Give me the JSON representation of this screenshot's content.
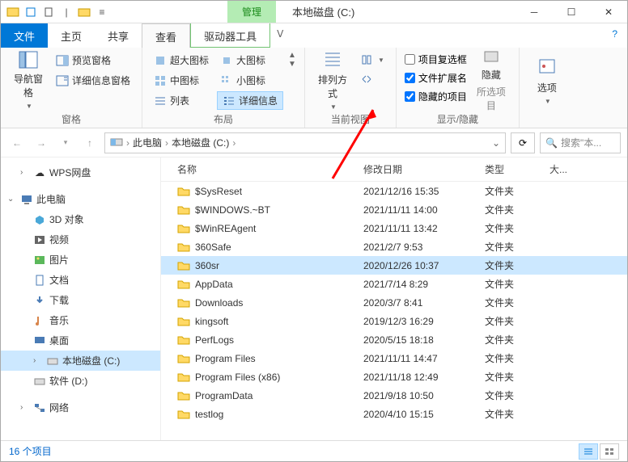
{
  "titlebar": {
    "manage_tab": "管理",
    "title": "本地磁盘 (C:)"
  },
  "menutabs": {
    "file": "文件",
    "home": "主页",
    "share": "共享",
    "view": "查看",
    "drive_tools": "驱动器工具"
  },
  "ribbon": {
    "panes": {
      "nav_pane": "导航窗格",
      "preview_pane": "预览窗格",
      "details_pane": "详细信息窗格",
      "group_label": "窗格"
    },
    "layout": {
      "xl_icons": "超大图标",
      "lg_icons": "大图标",
      "md_icons": "中图标",
      "sm_icons": "小图标",
      "list": "列表",
      "details": "详细信息",
      "group_label": "布局"
    },
    "current_view": {
      "sort_by": "排列方式",
      "group_label": "当前视图"
    },
    "show_hide": {
      "item_checkboxes": "项目复选框",
      "file_ext": "文件扩展名",
      "hidden_items": "隐藏的项目",
      "hide_selected": "隐藏",
      "hide_selected2": "所选项目",
      "group_label": "显示/隐藏"
    },
    "options": {
      "label": "选项"
    }
  },
  "breadcrumb": {
    "this_pc": "此电脑",
    "drive": "本地磁盘 (C:)"
  },
  "search": {
    "placeholder": "搜索\"本..."
  },
  "columns": {
    "name": "名称",
    "date": "修改日期",
    "type": "类型",
    "size": "大..."
  },
  "sidebar": {
    "wps": "WPS网盘",
    "this_pc": "此电脑",
    "objects3d": "3D 对象",
    "videos": "视频",
    "pictures": "图片",
    "documents": "文档",
    "downloads": "下载",
    "music": "音乐",
    "desktop": "桌面",
    "drive_c": "本地磁盘 (C:)",
    "drive_d": "软件 (D:)",
    "network": "网络"
  },
  "files": [
    {
      "name": "$SysReset",
      "date": "2021/12/16 15:35",
      "type": "文件夹"
    },
    {
      "name": "$WINDOWS.~BT",
      "date": "2021/11/11 14:00",
      "type": "文件夹"
    },
    {
      "name": "$WinREAgent",
      "date": "2021/11/11 13:42",
      "type": "文件夹"
    },
    {
      "name": "360Safe",
      "date": "2021/2/7 9:53",
      "type": "文件夹"
    },
    {
      "name": "360sr",
      "date": "2020/12/26 10:37",
      "type": "文件夹"
    },
    {
      "name": "AppData",
      "date": "2021/7/14 8:29",
      "type": "文件夹"
    },
    {
      "name": "Downloads",
      "date": "2020/3/7 8:41",
      "type": "文件夹"
    },
    {
      "name": "kingsoft",
      "date": "2019/12/3 16:29",
      "type": "文件夹"
    },
    {
      "name": "PerfLogs",
      "date": "2020/5/15 18:18",
      "type": "文件夹"
    },
    {
      "name": "Program Files",
      "date": "2021/11/11 14:47",
      "type": "文件夹"
    },
    {
      "name": "Program Files (x86)",
      "date": "2021/11/18 12:49",
      "type": "文件夹"
    },
    {
      "name": "ProgramData",
      "date": "2021/9/18 10:50",
      "type": "文件夹"
    },
    {
      "name": "testlog",
      "date": "2020/4/10 15:15",
      "type": "文件夹"
    }
  ],
  "status": {
    "count": "16 个项目"
  }
}
